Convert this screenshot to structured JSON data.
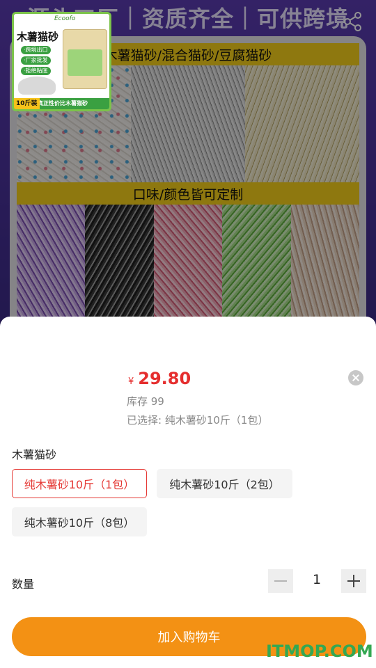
{
  "banner": {
    "headline": "源头工厂｜资质齐全｜可供跨境",
    "caption_top": "木薯猫砂/混合猫砂/豆腐猫砂",
    "caption_middle": "口味/颜色皆可定制"
  },
  "icons": {
    "back": "back-arrow-icon",
    "share": "share-icon",
    "close": "close-circle-icon",
    "minus": "minus-icon",
    "plus": "plus-icon"
  },
  "thumbnail": {
    "brand": "Ecoofo",
    "title": "木薯猫砂",
    "tags": [
      "·跨境出口",
      "·厂家批发",
      "·拒绝粘底"
    ],
    "badge": "10斤装",
    "bottom_text": "真正性价比木薯猫砂"
  },
  "product": {
    "currency": "¥",
    "price": "29.80",
    "stock": "库存 99",
    "selected": "已选择: 纯木薯砂10斤（1包）"
  },
  "spec": {
    "group_title": "木薯猫砂",
    "options": [
      {
        "label": "纯木薯砂10斤（1包）",
        "selected": true
      },
      {
        "label": "纯木薯砂10斤（2包）",
        "selected": false
      },
      {
        "label": "纯木薯砂10斤（8包）",
        "selected": false
      }
    ]
  },
  "quantity": {
    "label": "数量",
    "value": "1"
  },
  "cart_button": "加入购物车",
  "watermark": "ITMOP.COM",
  "colors": {
    "accent": "#f39114",
    "price": "#e52e2e",
    "selected_border": "#e53935"
  }
}
